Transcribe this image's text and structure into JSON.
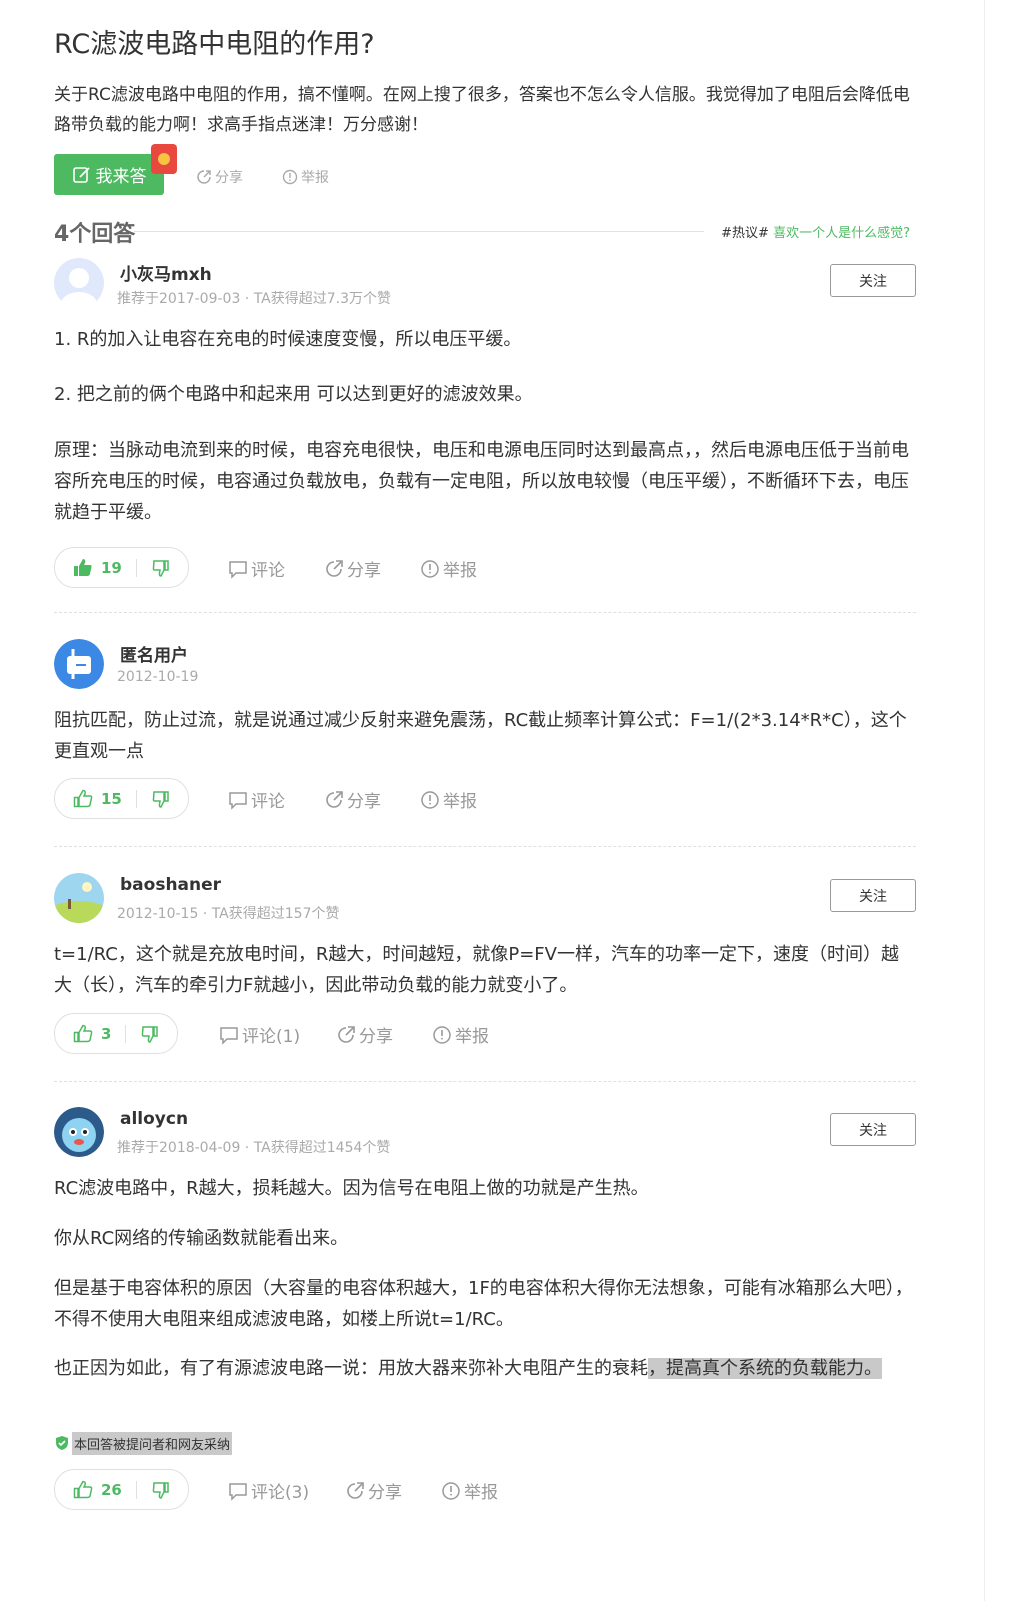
{
  "question": {
    "title": "RC滤波电路中电阻的作用?",
    "description": "关于RC滤波电路中电阻的作用，搞不懂啊。在网上搜了很多，答案也不怎么令人信服。我觉得加了电阻后会降低电路带负载的能力啊！求高手指点迷津！万分感谢！",
    "answer_button": "我来答",
    "share_label": "分享",
    "report_label": "举报"
  },
  "answers_header": {
    "count_label": "4个回答",
    "hot_tag": "#热议#",
    "hot_link": "喜欢一个人是什么感觉?"
  },
  "labels": {
    "follow": "关注",
    "comment": "评论",
    "share": "分享",
    "report": "举报"
  },
  "answers": [
    {
      "user": "小灰马mxh",
      "meta": "推荐于2017-09-03 · TA获得超过7.3万个赞",
      "paragraphs": [
        "1. R的加入让电容在充电的时候速度变慢，所以电压平缓。",
        "2. 把之前的俩个电路中和起来用 可以达到更好的滤波效果。",
        "原理：当脉动电流到来的时候，电容充电很快，电压和电源电压同时达到最高点，，然后电源电压低于当前电容所充电压的时候，电容通过负载放电，负载有一定电阻，所以放电较慢（电压平缓），不断循环下去，电压就趋于平缓。"
      ],
      "likes": "19",
      "comment_label": "评论"
    },
    {
      "user": "匿名用户",
      "meta": "2012-10-19",
      "paragraphs": [
        "阻抗匹配，防止过流，就是说通过减少反射来避免震荡，RC截止频率计算公式：F=1/(2*3.14*R*C），这个更直观一点"
      ],
      "likes": "15",
      "comment_label": "评论"
    },
    {
      "user": "baoshaner",
      "meta": "2012-10-15 · TA获得超过157个赞",
      "paragraphs": [
        "t=1/RC，这个就是充放电时间，R越大，时间越短，就像P=FV一样，汽车的功率一定下，速度（时间）越大（长），汽车的牵引力F就越小，因此带动负载的能力就变小了。"
      ],
      "likes": "3",
      "comment_label": "评论(1)"
    },
    {
      "user": "alloycn",
      "meta": "推荐于2018-04-09 · TA获得超过1454个赞",
      "paragraphs": [
        "RC滤波电路中，R越大，损耗越大。因为信号在电阻上做的功就是产生热。",
        "你从RC网络的传输函数就能看出来。",
        "但是基于电容体积的原因（大容量的电容体积越大，1F的电容体积大得你无法想象，可能有冰箱那么大吧），不得不使用大电阻来组成滤波电路，如楼上所说t=1/RC。"
      ],
      "last_para_plain": "也正因为如此，有了有源滤波电路一说：用放大器来弥补大电阻产生的衰耗",
      "last_para_highlight": "，提高真个系统的负载能力。",
      "adopted_label": "本回答被提问者和网友采纳",
      "likes": "26",
      "comment_label": "评论(3)"
    }
  ],
  "colors": {
    "brand_green": "#4dba62",
    "highlight_gray": "#c9c9c9",
    "muted_text": "#aaa"
  }
}
